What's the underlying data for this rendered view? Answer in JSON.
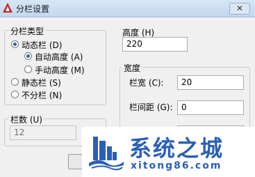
{
  "window": {
    "title": "分栏设置",
    "close_label": "✕"
  },
  "column_type": {
    "title": "分栏类型",
    "options": [
      {
        "label": "动态栏 (D)",
        "selected": true
      },
      {
        "label": "自动高度 (A)",
        "selected": true
      },
      {
        "label": "手动高度 (M)",
        "selected": false
      },
      {
        "label": "静态栏 (S)",
        "selected": false
      },
      {
        "label": "不分栏 (N)",
        "selected": false
      }
    ]
  },
  "column_count": {
    "title": "栏数 (U)",
    "value": "12"
  },
  "height": {
    "title": "高度 (H)",
    "value": "220"
  },
  "width": {
    "title": "宽度",
    "column_width_label": "栏宽 (C):",
    "column_width_value": "20",
    "gutter_label": "栏间距 (G):",
    "gutter_value": "0"
  },
  "watermark": {
    "name": "系统之城",
    "url": "xitong86.com"
  },
  "colors": {
    "accent": "#2a62b8",
    "watermark": "#2a5fb6"
  }
}
